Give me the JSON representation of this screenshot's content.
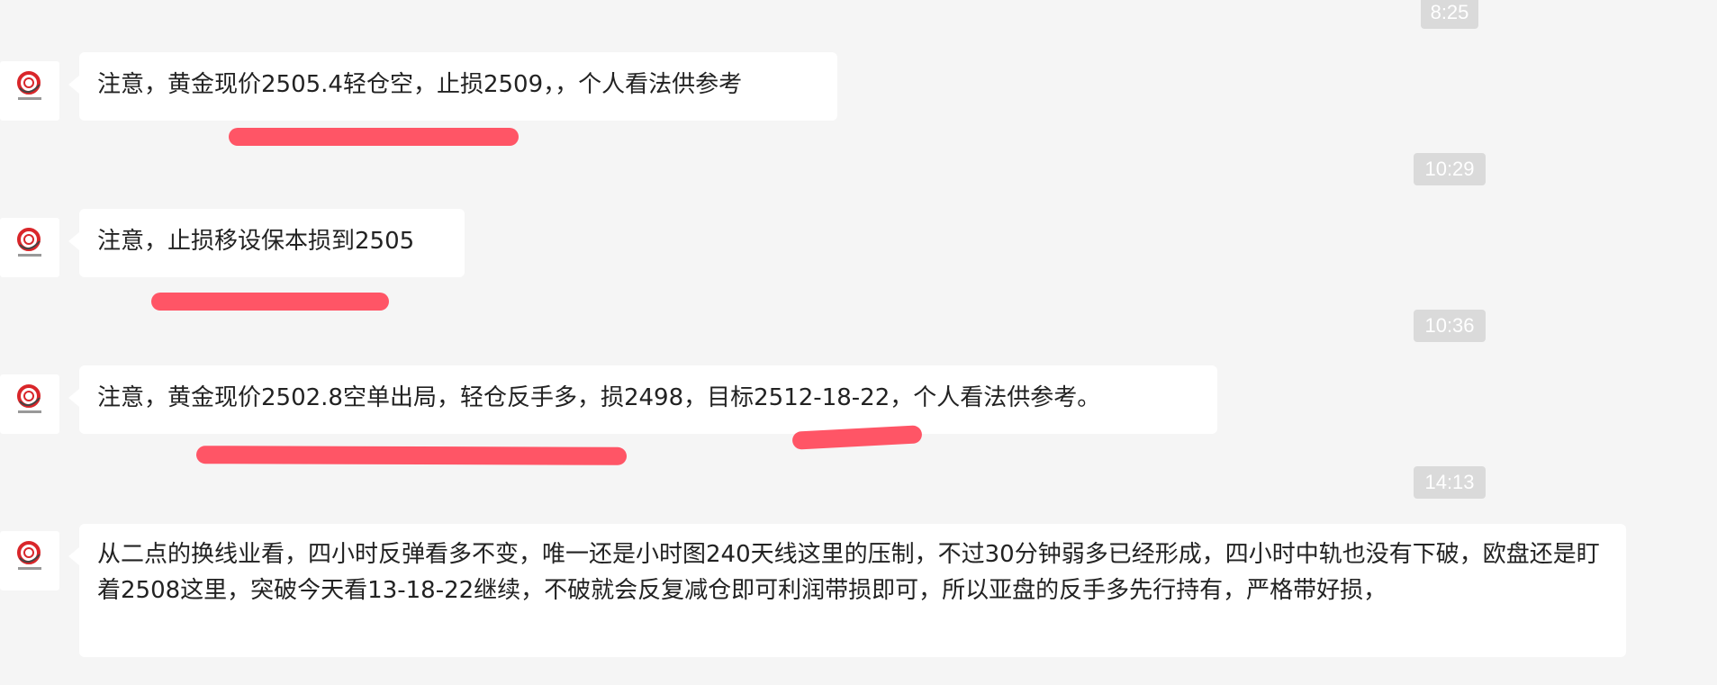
{
  "chat": {
    "messages": [
      {
        "time": "8:25",
        "sender_avatar": "trading-logo-icon",
        "text": "注意，黄金现价2505.4轻仓空，止损2509，，个人看法供参考"
      },
      {
        "time": "10:29",
        "sender_avatar": "trading-logo-icon",
        "text": "注意，止损移设保本损到2505"
      },
      {
        "time": "10:36",
        "sender_avatar": "trading-logo-icon",
        "text": "注意，黄金现价2502.8空单出局，轻仓反手多，损2498，目标2512-18-22，个人看法供参考。"
      },
      {
        "time": "14:13",
        "sender_avatar": "trading-logo-icon",
        "text": "从二点的换线业看，四小时反弹看多不变，唯一还是小时图240天线这里的压制，不过30分钟弱多已经形成，四小时中轨也没有下破，欧盘还是盯着2508这里，突破今天看13-18-22继续，不破就会反复减仓即可利润带损即可，所以亚盘的反手多先行持有，严格带好损，"
      }
    ]
  },
  "colors": {
    "background": "#f5f5f5",
    "bubble": "#ffffff",
    "timestamp_bg": "#dadada",
    "highlight_mark": "#ff5566",
    "logo_red": "#d9262a"
  }
}
